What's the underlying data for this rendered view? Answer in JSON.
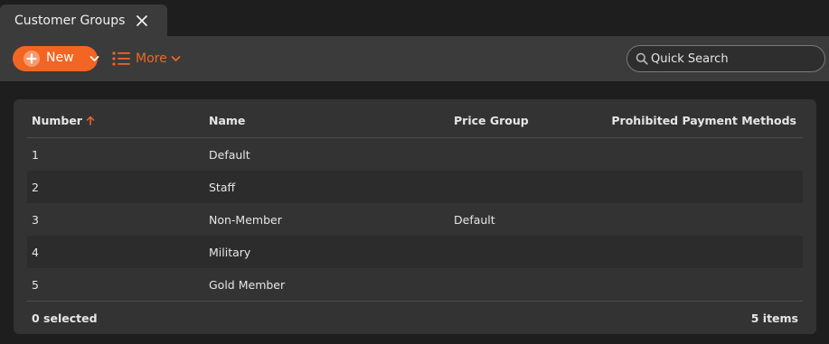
{
  "tab": {
    "title": "Customer Groups"
  },
  "toolbar": {
    "new_label": "New",
    "more_label": "More",
    "search_placeholder": "Quick Search"
  },
  "colors": {
    "accent": "#f26522",
    "background": "#1e1e1e",
    "panel": "#333333"
  },
  "table": {
    "columns": [
      "Number",
      "Name",
      "Price Group",
      "Prohibited Payment Methods"
    ],
    "sort": {
      "column": "Number",
      "direction": "ascending"
    },
    "rows": [
      {
        "number": "1",
        "name": "Default",
        "price_group": "",
        "prohibited": ""
      },
      {
        "number": "2",
        "name": "Staff",
        "price_group": "",
        "prohibited": ""
      },
      {
        "number": "3",
        "name": "Non-Member",
        "price_group": "Default",
        "prohibited": ""
      },
      {
        "number": "4",
        "name": "Military",
        "price_group": "",
        "prohibited": ""
      },
      {
        "number": "5",
        "name": "Gold Member",
        "price_group": "",
        "prohibited": ""
      }
    ]
  },
  "footer": {
    "selected": "0 selected",
    "count": "5 items"
  }
}
